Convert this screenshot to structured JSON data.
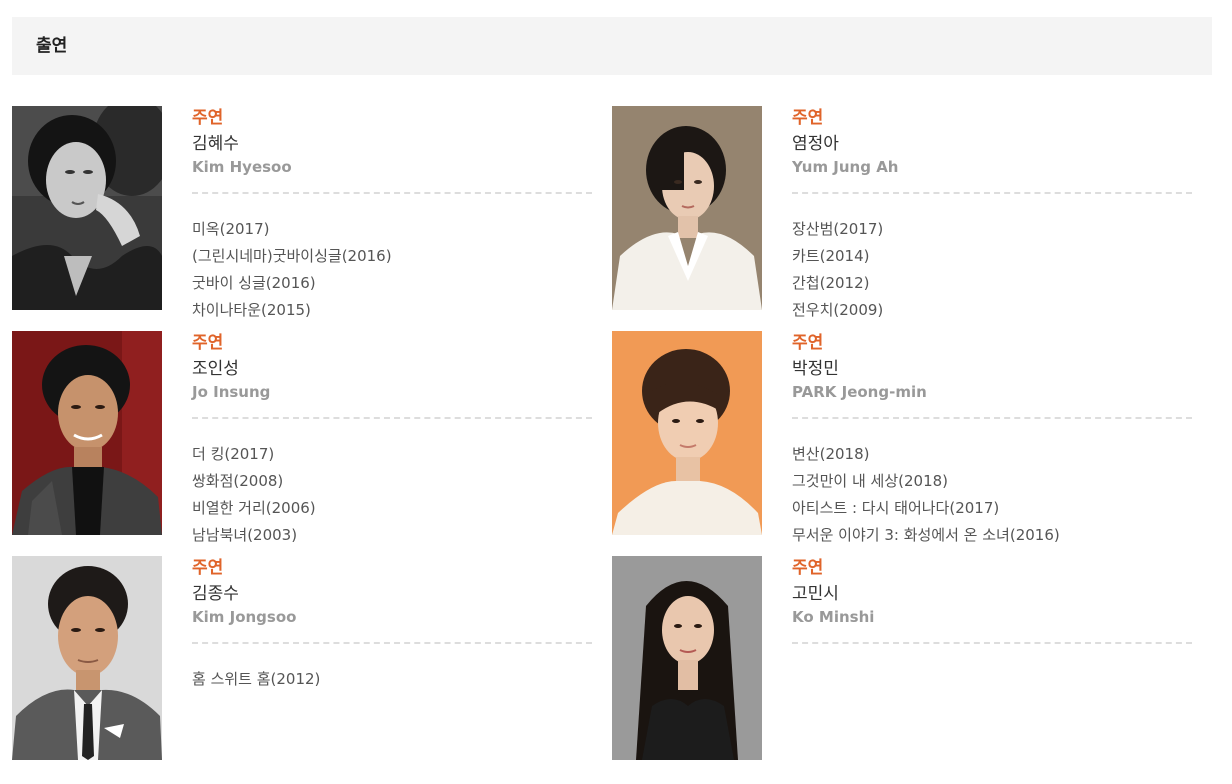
{
  "section": {
    "title": "출연"
  },
  "colors": {
    "role": "#e0642a",
    "name": "#333333",
    "english_name": "#999999",
    "header_bg": "#f4f4f4"
  },
  "cast": [
    {
      "role": "주연",
      "name_ko": "김혜수",
      "name_en": "Kim Hyesoo",
      "films": [
        "미옥(2017)",
        "(그린시네마)굿바이싱글(2016)",
        "굿바이 싱글(2016)",
        "차이나타운(2015)"
      ]
    },
    {
      "role": "주연",
      "name_ko": "염정아",
      "name_en": "Yum Jung Ah",
      "films": [
        "장산범(2017)",
        "카트(2014)",
        "간첩(2012)",
        "전우치(2009)"
      ]
    },
    {
      "role": "주연",
      "name_ko": "조인성",
      "name_en": "Jo Insung",
      "films": [
        "더 킹(2017)",
        "쌍화점(2008)",
        "비열한 거리(2006)",
        "남남북녀(2003)"
      ]
    },
    {
      "role": "주연",
      "name_ko": "박정민",
      "name_en": "PARK Jeong-min",
      "films": [
        "변산(2018)",
        "그것만이 내 세상(2018)",
        "아티스트 : 다시 태어나다(2017)",
        "무서운 이야기 3: 화성에서 온 소녀(2016)"
      ]
    },
    {
      "role": "주연",
      "name_ko": "김종수",
      "name_en": "Kim Jongsoo",
      "films": [
        "홈 스위트 홈(2012)"
      ]
    },
    {
      "role": "주연",
      "name_ko": "고민시",
      "name_en": "Ko Minshi",
      "films": []
    }
  ]
}
